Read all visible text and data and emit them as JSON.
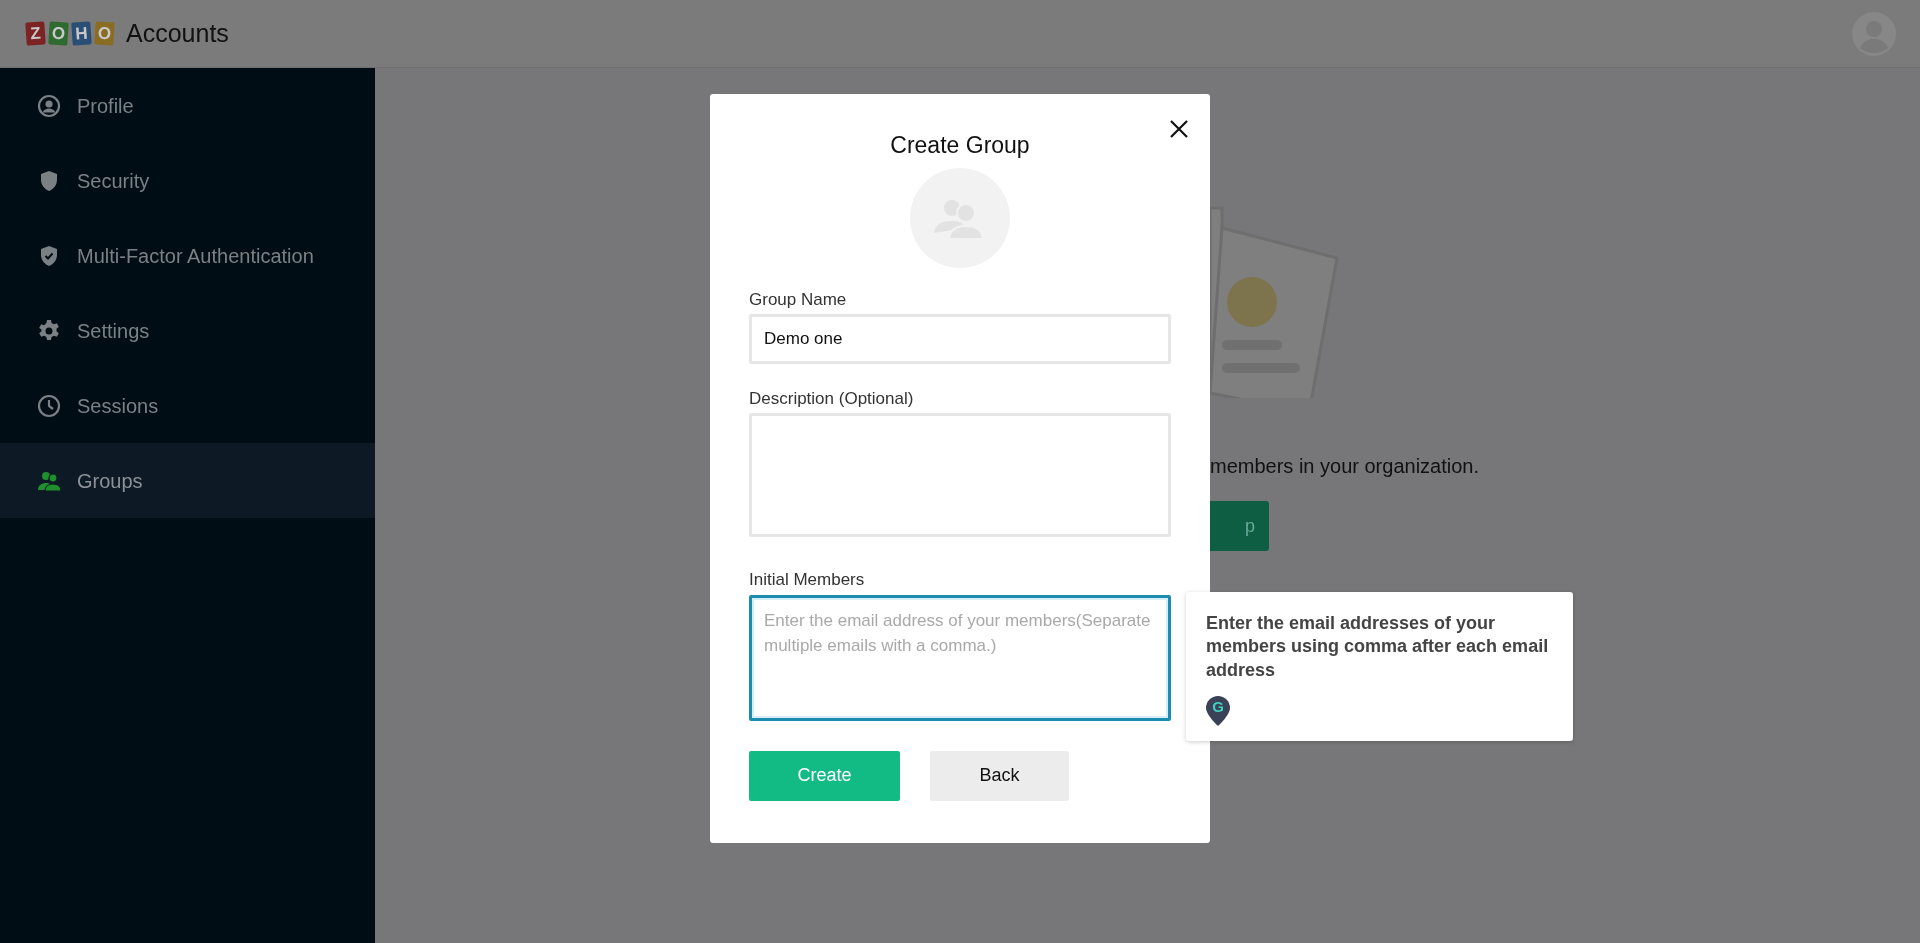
{
  "header": {
    "logo_letters": [
      {
        "char": "Z",
        "color": "#7c2323"
      },
      {
        "char": "O",
        "color": "#2f6a30"
      },
      {
        "char": "H",
        "color": "#2b4e76"
      },
      {
        "char": "O",
        "color": "#8a6d22"
      }
    ],
    "app_name": "Accounts"
  },
  "sidebar": {
    "items": [
      {
        "label": "Profile",
        "selected": false
      },
      {
        "label": "Security",
        "selected": false
      },
      {
        "label": "Multi-Factor Authentication",
        "selected": false
      },
      {
        "label": "Settings",
        "selected": false
      },
      {
        "label": "Sessions",
        "selected": false
      },
      {
        "label": "Groups",
        "selected": true
      }
    ]
  },
  "page": {
    "message": "members in your organization.",
    "button": "p"
  },
  "dialog": {
    "title": "Create Group",
    "fields": [
      {
        "label": "Group Name",
        "kind": "input",
        "value": "Demo one",
        "focused": false
      },
      {
        "label": "Description (Optional)",
        "kind": "textarea",
        "focused": false
      },
      {
        "label": "Initial Members",
        "kind": "textarea",
        "placeholder": "Enter the email address of your members(Separate multiple emails with a comma.)",
        "focused": true
      }
    ],
    "buttons": [
      {
        "label": "Create",
        "kind": "primary"
      },
      {
        "label": "Back",
        "kind": "secondary"
      }
    ]
  },
  "tooltip": {
    "text": "Enter the email addresses of your members using comma after each email address",
    "badge_letter": "G"
  }
}
